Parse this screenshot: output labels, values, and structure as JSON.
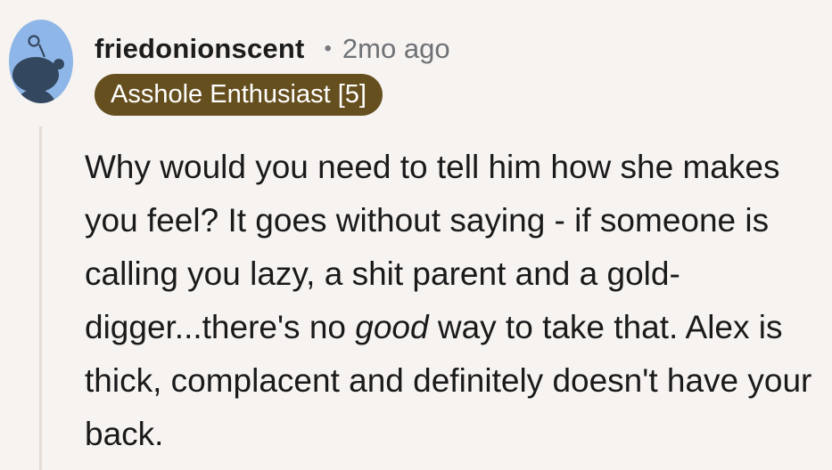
{
  "comment": {
    "username": "friedonionscent",
    "separator": "•",
    "timestamp": "2mo ago",
    "flair": "Asshole Enthusiast [5]",
    "flair_color": "#664f1f",
    "avatar_color": "#8fb6e8",
    "avatar_icon": "snoo-avatar-icon",
    "body": {
      "before_emphasis": "Why would you need to tell him how she makes you feel? It goes without saying - if someone is calling you lazy, a shit parent and a gold-digger...there's no ",
      "emphasis": "good",
      "after_emphasis": " way to take that. Alex is thick, complacent and definitely doesn't have your back."
    }
  }
}
